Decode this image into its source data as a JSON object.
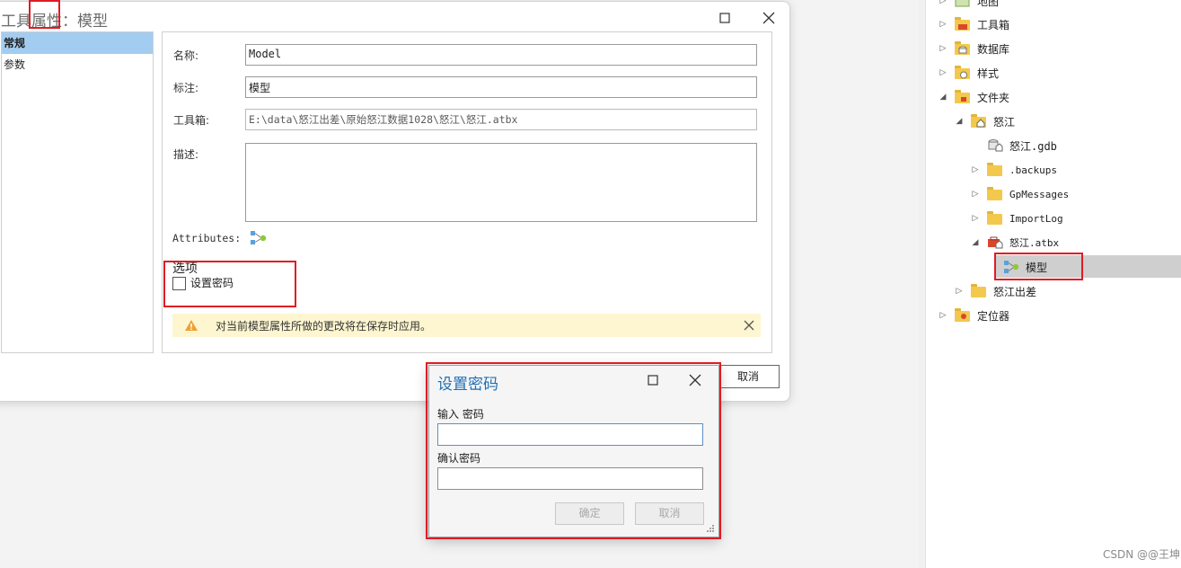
{
  "dialog": {
    "title": "工具属性：模型",
    "nav": [
      "常规",
      "参数"
    ],
    "labels": {
      "name": "名称:",
      "label": "标注:",
      "toolbox": "工具箱:",
      "description": "描述:",
      "attributes": "Attributes:"
    },
    "values": {
      "name": "Model",
      "label": "模型",
      "toolbox": "E:\\data\\怒江出差\\原始怒江数据1028\\怒江\\怒江.atbx",
      "description": ""
    },
    "options_heading": "选项",
    "set_password_label": "设置密码",
    "set_password_checked": false,
    "notice": "对当前模型属性所做的更改将在保存时应用。",
    "cancel_label": "取消"
  },
  "password_dialog": {
    "title": "设置密码",
    "enter_label": "输入 密码",
    "confirm_label": "确认密码",
    "enter_value": "",
    "confirm_value": "",
    "ok_label": "确定",
    "cancel_label": "取消"
  },
  "catalog": {
    "items": [
      {
        "label": "地图",
        "icon": "map-icon",
        "level": 0,
        "expander": "collapsed"
      },
      {
        "label": "工具箱",
        "icon": "toolbox-icon",
        "level": 0,
        "expander": "collapsed"
      },
      {
        "label": "数据库",
        "icon": "database-icon",
        "level": 0,
        "expander": "collapsed"
      },
      {
        "label": "样式",
        "icon": "style-icon",
        "level": 0,
        "expander": "collapsed"
      },
      {
        "label": "文件夹",
        "icon": "folder-icon",
        "level": 0,
        "expander": "expanded"
      },
      {
        "label": "怒江",
        "icon": "home-folder-icon",
        "level": 1,
        "expander": "expanded"
      },
      {
        "label": "怒江.gdb",
        "icon": "geodatabase-icon",
        "level": 2,
        "expander": "none"
      },
      {
        "label": ".backups",
        "icon": "folder-icon",
        "level": 2,
        "expander": "collapsed"
      },
      {
        "label": "GpMessages",
        "icon": "folder-icon",
        "level": 2,
        "expander": "collapsed"
      },
      {
        "label": "ImportLog",
        "icon": "folder-icon",
        "level": 2,
        "expander": "collapsed"
      },
      {
        "label": "怒江.atbx",
        "icon": "atbx-toolbox-icon",
        "level": 2,
        "expander": "expanded"
      },
      {
        "label": "模型",
        "icon": "model-icon",
        "level": 3,
        "expander": "none",
        "selected": true
      },
      {
        "label": "怒江出差",
        "icon": "folder-icon",
        "level": 1,
        "expander": "collapsed"
      },
      {
        "label": "定位器",
        "icon": "locator-icon",
        "level": 0,
        "expander": "collapsed"
      }
    ]
  },
  "watermark": "CSDN @@王坤",
  "colors": {
    "highlight": "#e01b24",
    "selection": "#a3cdf0",
    "notice_bg": "#fdf6d0",
    "title_blue": "#1f6fb5"
  }
}
